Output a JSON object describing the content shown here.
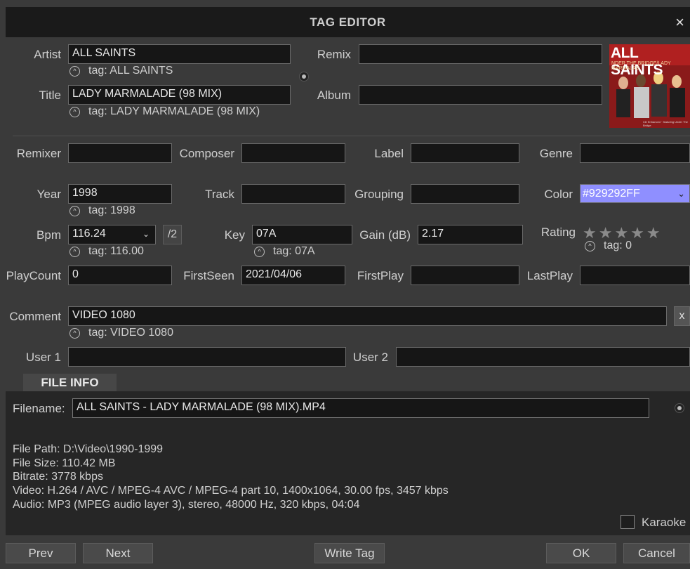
{
  "window": {
    "title": "TAG EDITOR",
    "close_label": "×"
  },
  "fields": {
    "artist": {
      "label": "Artist",
      "value": "ALL SAINTS",
      "tag": "tag: ALL SAINTS"
    },
    "title": {
      "label": "Title",
      "value": "LADY MARMALADE (98 MIX)",
      "tag": "tag: LADY MARMALADE (98 MIX)"
    },
    "remix": {
      "label": "Remix",
      "value": ""
    },
    "album": {
      "label": "Album",
      "value": ""
    },
    "remixer": {
      "label": "Remixer",
      "value": ""
    },
    "composer": {
      "label": "Composer",
      "value": ""
    },
    "label": {
      "label": "Label",
      "value": ""
    },
    "genre": {
      "label": "Genre",
      "value": ""
    },
    "year": {
      "label": "Year",
      "value": "1998",
      "tag": "tag: 1998"
    },
    "track": {
      "label": "Track",
      "value": ""
    },
    "grouping": {
      "label": "Grouping",
      "value": ""
    },
    "color": {
      "label": "Color",
      "value": "#929292FF",
      "swatch": "#8f8fff"
    },
    "bpm": {
      "label": "Bpm",
      "value": "116.24",
      "tag": "tag: 116.00",
      "half_label": "/2"
    },
    "key": {
      "label": "Key",
      "value": "07A",
      "tag": "tag: 07A"
    },
    "gain": {
      "label": "Gain (dB)",
      "value": "2.17"
    },
    "rating": {
      "label": "Rating",
      "stars": "★★★★★",
      "value": 0,
      "tag": "tag: 0"
    },
    "playcount": {
      "label": "PlayCount",
      "value": "0"
    },
    "firstseen": {
      "label": "FirstSeen",
      "value": "2021/04/06"
    },
    "firstplay": {
      "label": "FirstPlay",
      "value": ""
    },
    "lastplay": {
      "label": "LastPlay",
      "value": ""
    },
    "comment": {
      "label": "Comment",
      "value": "VIDEO 1080",
      "tag": "tag: VIDEO 1080",
      "clear_label": "x"
    },
    "user1": {
      "label": "User 1",
      "value": ""
    },
    "user2": {
      "label": "User 2",
      "value": ""
    }
  },
  "cover": {
    "text_main": "ALL SAINTS",
    "text_sub": "NDER THE BRIDGE/LADY MARMALAD",
    "text_small": "CD Enhanced · featuring Under The Bridge"
  },
  "file_info": {
    "tab_label": "FILE INFO",
    "filename_label": "Filename:",
    "filename": "ALL SAINTS - LADY MARMALADE (98 MIX).MP4",
    "lines": [
      "File Path: D:\\Video\\1990-1999",
      "File Size: 110.42 MB",
      "Bitrate: 3778 kbps",
      "Video: H.264 / AVC / MPEG-4 AVC / MPEG-4 part 10, 1400x1064, 30.00 fps, 3457 kbps",
      "Audio: MP3 (MPEG audio layer 3), stereo, 48000 Hz, 320 kbps, 04:04"
    ],
    "karaoke_label": "Karaoke",
    "karaoke_checked": false
  },
  "buttons": {
    "prev": "Prev",
    "next": "Next",
    "write_tag": "Write Tag",
    "ok": "OK",
    "cancel": "Cancel"
  },
  "tag_icon_glyph": "^"
}
